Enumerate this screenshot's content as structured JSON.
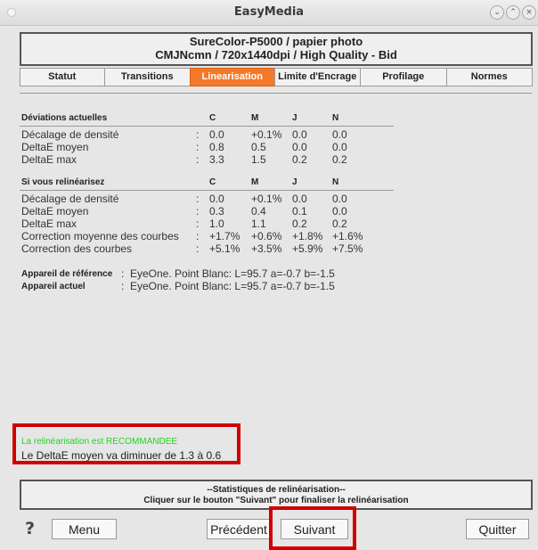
{
  "window": {
    "title": "EasyMedia"
  },
  "printer": {
    "line1": "SureColor-P5000 / papier photo",
    "line2": "CMJNcmn / 720x1440dpi / High Quality - Bid"
  },
  "tabs": [
    {
      "label": "Statut"
    },
    {
      "label": "Transitions"
    },
    {
      "label": "Linearisation",
      "active": true
    },
    {
      "label": "Limite d'Encrage"
    },
    {
      "label": "Profilage"
    },
    {
      "label": "Normes"
    }
  ],
  "current": {
    "heading": "Déviations actuelles",
    "cols": [
      "C",
      "M",
      "J",
      "N"
    ],
    "rows": [
      {
        "label": "Décalage de densité",
        "sep": ":",
        "values": [
          "0.0",
          "+0.1%",
          "0.0",
          "0.0"
        ]
      },
      {
        "label": "DeltaE moyen",
        "sep": ":",
        "values": [
          "0.8",
          "0.5",
          "0.0",
          "0.0"
        ]
      },
      {
        "label": "DeltaE max",
        "sep": ":",
        "values": [
          "3.3",
          "1.5",
          "0.2",
          "0.2"
        ]
      }
    ]
  },
  "projected": {
    "heading": "Si vous relinéarisez",
    "cols": [
      "C",
      "M",
      "J",
      "N"
    ],
    "rows": [
      {
        "label": "Décalage de densité",
        "sep": ":",
        "values": [
          "0.0",
          "+0.1%",
          "0.0",
          "0.0"
        ]
      },
      {
        "label": "DeltaE moyen",
        "sep": ":",
        "values": [
          "0.3",
          "0.4",
          "0.1",
          "0.0"
        ]
      },
      {
        "label": "DeltaE max",
        "sep": ":",
        "values": [
          "1.0",
          "1.1",
          "0.2",
          "0.2"
        ]
      },
      {
        "label": "Correction moyenne des courbes",
        "sep": ":",
        "values": [
          "+1.7%",
          "+0.6%",
          "+1.8%",
          "+1.6%"
        ]
      },
      {
        "label": "Correction des courbes",
        "sep": ":",
        "values": [
          "+5.1%",
          "+3.5%",
          "+5.9%",
          "+7.5%"
        ]
      }
    ]
  },
  "devices": [
    {
      "label": "Appareil de référence",
      "sep": ":",
      "value": "EyeOne.  Point Blanc: L=95.7 a=-0.7 b=-1.5"
    },
    {
      "label": "Appareil actuel",
      "sep": ":",
      "value": "EyeOne.  Point Blanc: L=95.7 a=-0.7 b=-1.5"
    }
  ],
  "message": {
    "recommend": "La relinéarisation est RECOMMANDEE",
    "detail": "Le DeltaE moyen va diminuer de 1.3 à 0.6"
  },
  "stats": {
    "line1": "--Statistiques de relinéarisation--",
    "line2": "Cliquer sur le bouton \"Suivant\" pour finaliser la relinéarisation"
  },
  "buttons": {
    "help": "?",
    "menu": "Menu",
    "previous": "Précédent",
    "next": "Suivant",
    "quit": "Quitter"
  },
  "colors": {
    "accent": "#f57a28",
    "highlight": "#d00000",
    "recommend": "#1cd81c"
  }
}
